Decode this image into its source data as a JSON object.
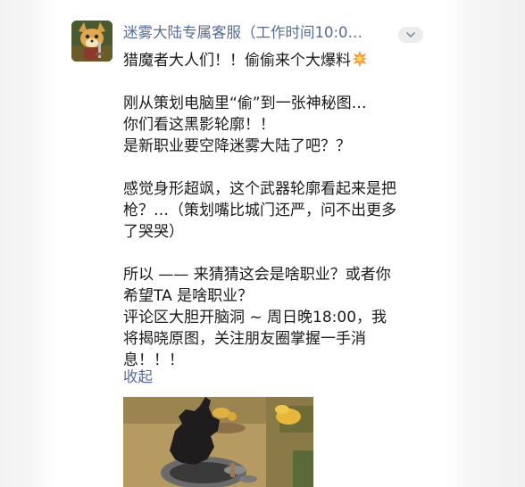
{
  "account": {
    "avatar_icon": "game-character-avatar-icon",
    "name": "迷雾大陆专属客服（工作时间10:0…",
    "expand_icon": "chevron-down-icon"
  },
  "post": {
    "line1": "猎魔者大人们！！偷偷来个大爆料",
    "line1_emoji": "collision-icon",
    "line2": "刚从策划电脑里“偷”到一张神秘图…",
    "line3": "你们看这黑影轮廓！！",
    "line4": "是新职业要空降迷雾大陆了吧？？",
    "line5": "感觉身形超飒，这个武器轮廓看起来是把",
    "line6": "枪？…（策划嘴比城门还严，问不出更多",
    "line7": "了哭哭）",
    "line8": "所以 —— 来猜猜这会是啥职业？或者你",
    "line9": "希望TA 是啥职业？",
    "line10": "评论区大胆开脑洞 ~ 周日晚18:00，我",
    "line11": "将揭晓原图，关注朋友圈掌握一手消",
    "line12": "息！！！"
  },
  "collapse_label": "收起",
  "image": {
    "icon": "silhouette-teaser-image"
  },
  "colors": {
    "link": "#576b95",
    "text": "#1a1a1a",
    "background": "#ffffff"
  }
}
